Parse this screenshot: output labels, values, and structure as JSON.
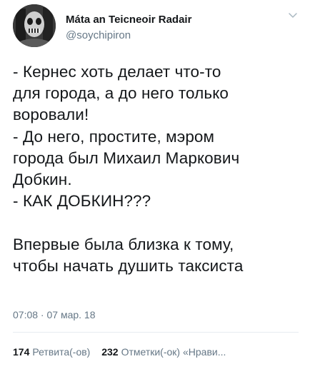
{
  "user": {
    "name": "Máta an Teicneoir Radair",
    "handle": "@soychipiron"
  },
  "tweet": {
    "text": "- Кернес хоть делает что-то\nдля города, а до него только\nворовали!\n- До него, простите, мэром\nгорода был Михаил Маркович\nДобкин.\n- КАК ДОБКИН???\n\nВпервые была близка к тому,\nчтобы начать душить таксиста"
  },
  "meta": {
    "timestamp": "07:08 · 07 мар. 18"
  },
  "stats": {
    "retweets_count": "174",
    "retweets_label": "Ретвита(-ов)",
    "likes_count": "232",
    "likes_label": "Отметки(-ок) «Нрави..."
  },
  "icons": {
    "menu": "chevron-down-icon"
  },
  "colors": {
    "text_primary": "#14171a",
    "text_secondary": "#657786",
    "divider": "#e6ecf0"
  }
}
